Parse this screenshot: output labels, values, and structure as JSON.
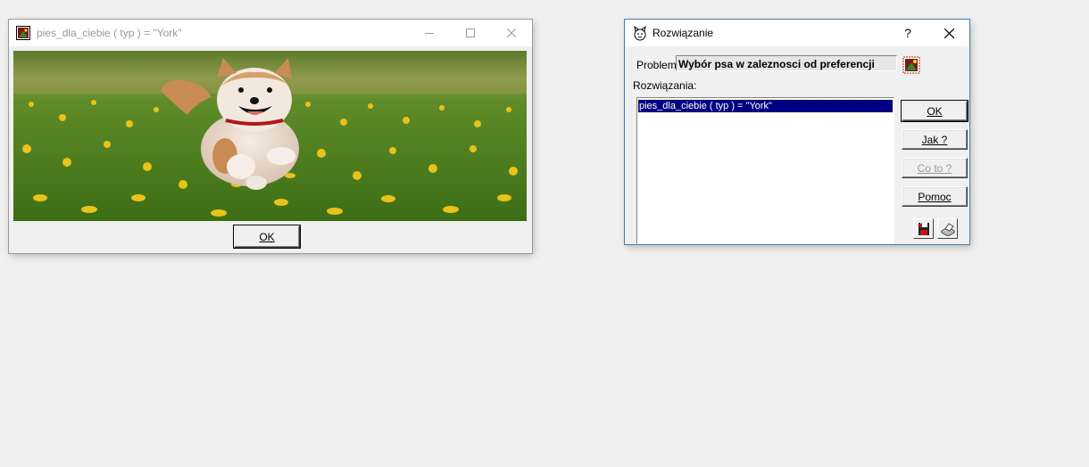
{
  "image_window": {
    "title": "pies_dla_ciebie ( typ ) = \"York\"",
    "ok_label": "OK",
    "minimize_icon": "minimize-icon",
    "maximize_icon": "maximize-icon",
    "close_icon": "close-icon"
  },
  "solution_window": {
    "title": "Rozwiązanie",
    "help_label": "?",
    "problem_label": "Problem",
    "problem_value": "Wybór psa w zaleznosci od preferencji",
    "solutions_label": "Rozwiązania:",
    "solutions": [
      "pies_dla_ciebie ( typ ) = \"York\""
    ],
    "buttons": {
      "ok": "OK",
      "jak": "Jak ?",
      "coto": "Co to ?",
      "pomoc": "Pomoc"
    },
    "coto_disabled": true
  },
  "colors": {
    "selection": "#000080",
    "background": "#f0f0f0",
    "disabled_text": "#9a9a9a"
  }
}
